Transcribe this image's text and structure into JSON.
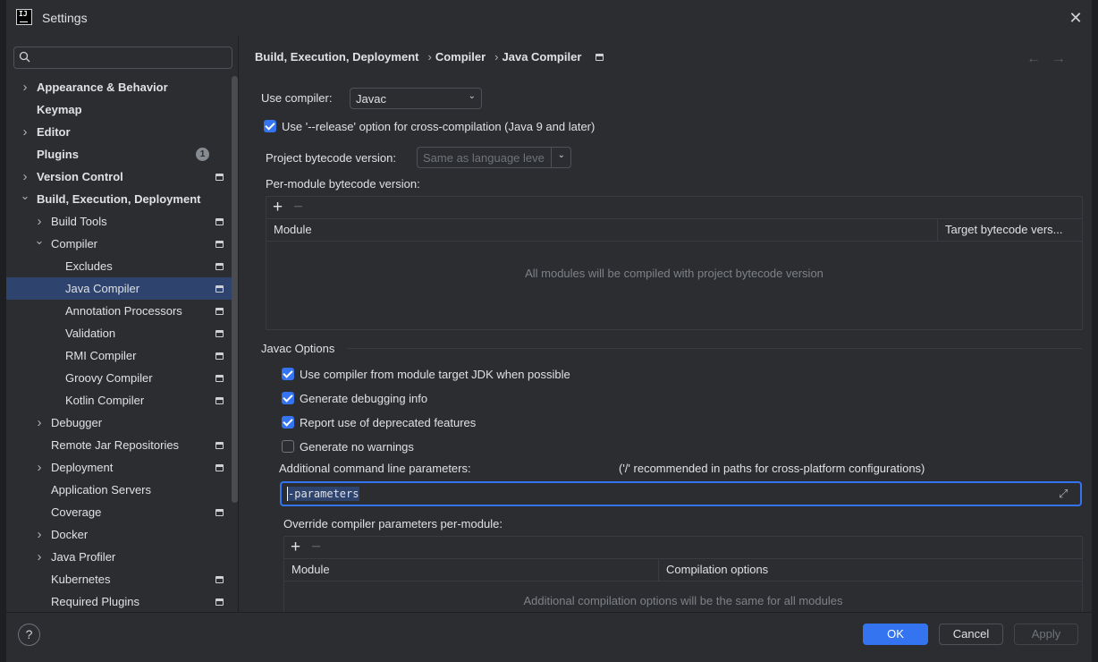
{
  "window": {
    "title": "Settings"
  },
  "search": {
    "placeholder": "",
    "value": ""
  },
  "sidebar": {
    "items": [
      {
        "label": "Appearance & Behavior",
        "level": 0,
        "chevron": "right",
        "bold": true,
        "project_icon": false
      },
      {
        "label": "Keymap",
        "level": 0,
        "chevron": "none",
        "bold": true,
        "project_icon": false
      },
      {
        "label": "Editor",
        "level": 0,
        "chevron": "right",
        "bold": true,
        "project_icon": false
      },
      {
        "label": "Plugins",
        "level": 0,
        "chevron": "none",
        "bold": true,
        "project_icon": false,
        "badge": "1"
      },
      {
        "label": "Version Control",
        "level": 0,
        "chevron": "right",
        "bold": true,
        "project_icon": true
      },
      {
        "label": "Build, Execution, Deployment",
        "level": 0,
        "chevron": "down",
        "bold": true,
        "project_icon": false
      },
      {
        "label": "Build Tools",
        "level": 1,
        "chevron": "right",
        "bold": false,
        "project_icon": true
      },
      {
        "label": "Compiler",
        "level": 1,
        "chevron": "down",
        "bold": false,
        "project_icon": true
      },
      {
        "label": "Excludes",
        "level": 2,
        "chevron": "none",
        "bold": false,
        "project_icon": true
      },
      {
        "label": "Java Compiler",
        "level": 2,
        "chevron": "none",
        "bold": false,
        "project_icon": true,
        "selected": true
      },
      {
        "label": "Annotation Processors",
        "level": 2,
        "chevron": "none",
        "bold": false,
        "project_icon": true
      },
      {
        "label": "Validation",
        "level": 2,
        "chevron": "none",
        "bold": false,
        "project_icon": true
      },
      {
        "label": "RMI Compiler",
        "level": 2,
        "chevron": "none",
        "bold": false,
        "project_icon": true
      },
      {
        "label": "Groovy Compiler",
        "level": 2,
        "chevron": "none",
        "bold": false,
        "project_icon": true
      },
      {
        "label": "Kotlin Compiler",
        "level": 2,
        "chevron": "none",
        "bold": false,
        "project_icon": true
      },
      {
        "label": "Debugger",
        "level": 1,
        "chevron": "right",
        "bold": false,
        "project_icon": false
      },
      {
        "label": "Remote Jar Repositories",
        "level": 1,
        "chevron": "none",
        "bold": false,
        "project_icon": true
      },
      {
        "label": "Deployment",
        "level": 1,
        "chevron": "right",
        "bold": false,
        "project_icon": true
      },
      {
        "label": "Application Servers",
        "level": 1,
        "chevron": "none",
        "bold": false,
        "project_icon": false
      },
      {
        "label": "Coverage",
        "level": 1,
        "chevron": "none",
        "bold": false,
        "project_icon": true
      },
      {
        "label": "Docker",
        "level": 1,
        "chevron": "right",
        "bold": false,
        "project_icon": false
      },
      {
        "label": "Java Profiler",
        "level": 1,
        "chevron": "right",
        "bold": false,
        "project_icon": false
      },
      {
        "label": "Kubernetes",
        "level": 1,
        "chevron": "none",
        "bold": false,
        "project_icon": true
      },
      {
        "label": "Required Plugins",
        "level": 1,
        "chevron": "none",
        "bold": false,
        "project_icon": true
      }
    ]
  },
  "breadcrumb": {
    "items": [
      "Build, Execution, Deployment",
      "Compiler",
      "Java Compiler"
    ],
    "separator": "›"
  },
  "nav": {
    "back": "←",
    "forward": "→"
  },
  "compiler": {
    "use_compiler_label": "Use compiler:",
    "use_compiler_value": "Javac",
    "release_option_label": "Use '--release' option for cross-compilation (Java 9 and later)",
    "release_option_checked": true,
    "project_bytecode_label": "Project bytecode version:",
    "project_bytecode_placeholder": "Same as language leve",
    "per_module_label": "Per-module bytecode version:",
    "per_module_table": {
      "columns": [
        "Module",
        "Target bytecode vers..."
      ],
      "empty_text": "All modules will be compiled with project bytecode version"
    }
  },
  "javac": {
    "section_title": "Javac Options",
    "options": [
      {
        "label": "Use compiler from module target JDK when possible",
        "checked": true
      },
      {
        "label": "Generate debugging info",
        "checked": true
      },
      {
        "label": "Report use of deprecated features",
        "checked": true
      },
      {
        "label": "Generate no warnings",
        "checked": false
      }
    ],
    "additional_label": "Additional command line parameters:",
    "additional_hint": "('/' recommended in paths for cross-platform configurations)",
    "additional_value": "-parameters",
    "override_label": "Override compiler parameters per-module:",
    "override_table": {
      "columns": [
        "Module",
        "Compilation options"
      ],
      "empty_text": "Additional compilation options will be the same for all modules"
    }
  },
  "footer": {
    "help": "?",
    "ok": "OK",
    "cancel": "Cancel",
    "apply": "Apply"
  },
  "colors": {
    "accent": "#3574f0",
    "selection": "#2e436e",
    "background": "#2b2d30"
  }
}
